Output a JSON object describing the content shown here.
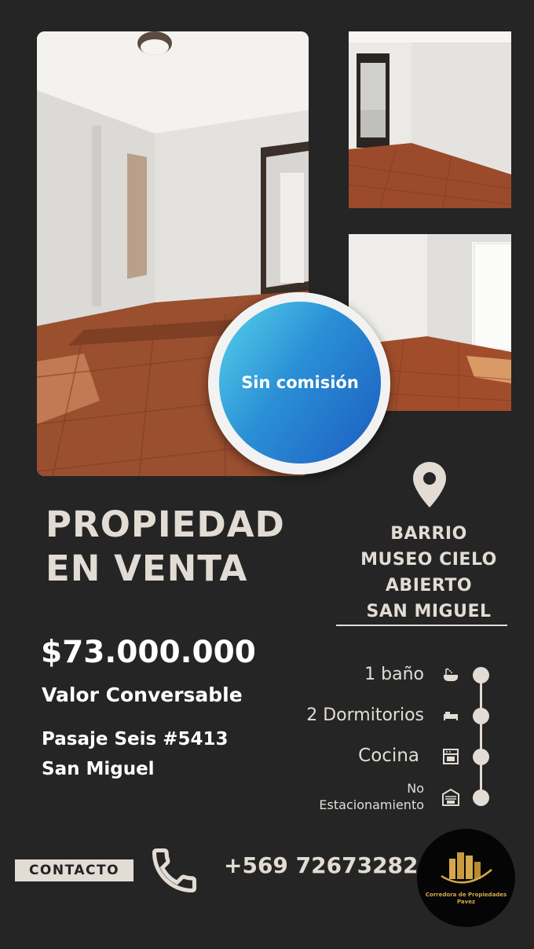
{
  "badge": {
    "text": "Sin comisión"
  },
  "headline": {
    "line1": "PROPIEDAD",
    "line2": "EN VENTA"
  },
  "price": "$73.000.000",
  "price_note": "Valor Conversable",
  "address": {
    "line1": "Pasaje Seis #5413",
    "line2": "San Miguel"
  },
  "location": {
    "icon": "map-pin-icon",
    "lines": [
      "BARRIO",
      "MUSEO CIELO",
      "ABIERTO",
      "SAN MIGUEL"
    ]
  },
  "features": [
    {
      "label": "1 baño",
      "icon": "bathtub-icon"
    },
    {
      "label": "2 Dormitorios",
      "icon": "bed-icon"
    },
    {
      "label": "Cocina",
      "icon": "stove-icon"
    },
    {
      "label_line1": "No",
      "label_line2": "Estacionamiento",
      "icon": "garage-icon"
    }
  ],
  "contact": {
    "label": "CONTACTO",
    "phone": "+569 72673282",
    "icon": "phone-icon"
  },
  "logo": {
    "line1": "Corredora de Propiedades",
    "line2": "Pavez"
  },
  "colors": {
    "background": "#252525",
    "accent": "#e2dcd5",
    "badge_blue": "#2a8fd6",
    "logo_gold": "#d4a94c"
  }
}
